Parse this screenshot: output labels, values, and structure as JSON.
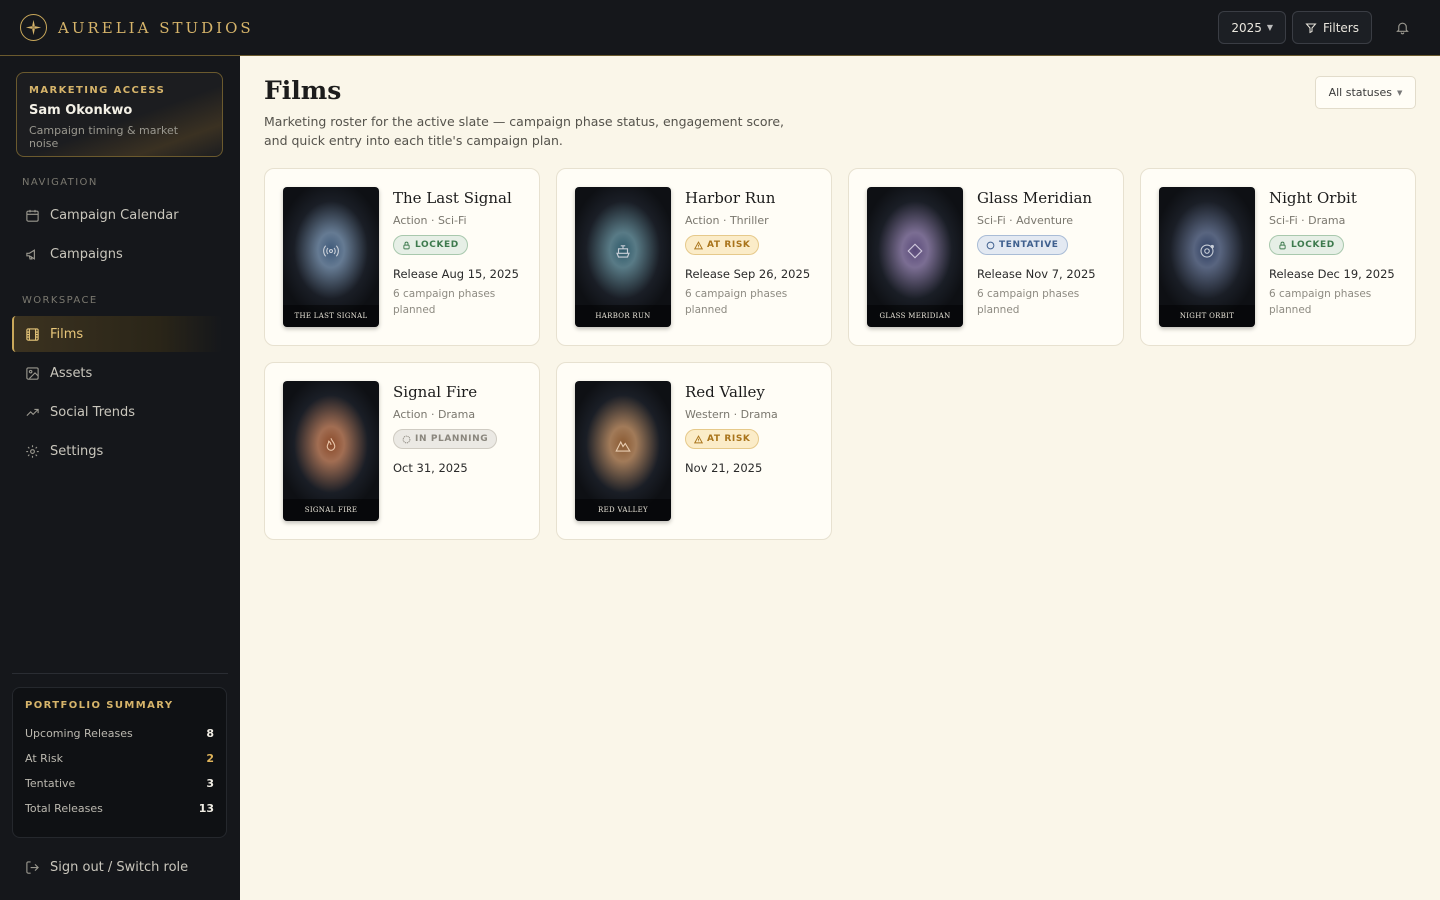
{
  "brand": {
    "name": "AURELIA STUDIOS",
    "icon": "star-compass-icon"
  },
  "topbar": {
    "year": "2025",
    "filters_label": "Filters"
  },
  "sidebar": {
    "access": {
      "label": "MARKETING ACCESS",
      "name": "Sam Okonkwo",
      "subtitle": "Campaign timing & market noise"
    },
    "navigation_label": "NAVIGATION",
    "navigation": [
      {
        "label": "Campaign Calendar",
        "icon": "calendar-icon"
      },
      {
        "label": "Campaigns",
        "icon": "megaphone-icon"
      }
    ],
    "workspace_label": "WORKSPACE",
    "workspace": [
      {
        "label": "Films",
        "icon": "film-icon",
        "active": true
      },
      {
        "label": "Assets",
        "icon": "image-icon"
      },
      {
        "label": "Social Trends",
        "icon": "trending-icon"
      },
      {
        "label": "Settings",
        "icon": "gear-icon"
      }
    ],
    "summary": {
      "title": "PORTFOLIO SUMMARY",
      "rows": [
        {
          "label": "Upcoming Releases",
          "value": "8"
        },
        {
          "label": "At Risk",
          "value": "2"
        },
        {
          "label": "Tentative",
          "value": "3"
        },
        {
          "label": "Total Releases",
          "value": "13"
        }
      ]
    },
    "signout_label": "Sign out / Switch role"
  },
  "main": {
    "title": "Films",
    "description": "Marketing roster for the active slate — campaign phase status, engagement score, and quick entry into each title's campaign plan.",
    "status_filter": "All statuses",
    "films": [
      {
        "title": "The Last Signal",
        "genre": "Action · Sci-Fi",
        "status": "LOCKED",
        "status_type": "locked",
        "release": "Release Aug 15, 2025",
        "phases": "6 campaign phases planned",
        "poster_title": "THE LAST SIGNAL",
        "poster_icon": "broadcast-icon",
        "poster_color": "#3f5a7a"
      },
      {
        "title": "Harbor Run",
        "genre": "Action · Thriller",
        "status": "AT RISK",
        "status_type": "risk",
        "release": "Release Sep 26, 2025",
        "phases": "6 campaign phases planned",
        "poster_title": "HARBOR RUN",
        "poster_icon": "ship-icon",
        "poster_color": "#2f5a6a"
      },
      {
        "title": "Glass Meridian",
        "genre": "Sci-Fi · Adventure",
        "status": "TENTATIVE",
        "status_type": "tentative",
        "release": "Release Nov 7, 2025",
        "phases": "6 campaign phases planned",
        "poster_title": "GLASS MERIDIAN",
        "poster_icon": "diamond-icon",
        "poster_color": "#5a4a7a"
      },
      {
        "title": "Night Orbit",
        "genre": "Sci-Fi · Drama",
        "status": "LOCKED",
        "status_type": "locked",
        "release": "Release Dec 19, 2025",
        "phases": "6 campaign phases planned",
        "poster_title": "NIGHT ORBIT",
        "poster_icon": "orbit-icon",
        "poster_color": "#2f3f62"
      },
      {
        "title": "Signal Fire",
        "genre": "Action · Drama",
        "status": "IN PLANNING",
        "status_type": "planning",
        "release": "Oct 31, 2025",
        "phases": "",
        "poster_title": "SIGNAL FIRE",
        "poster_icon": "flame-icon",
        "poster_color": "#8a4a2a"
      },
      {
        "title": "Red Valley",
        "genre": "Western · Drama",
        "status": "AT RISK",
        "status_type": "risk",
        "release": "Nov 21, 2025",
        "phases": "",
        "poster_title": "RED VALLEY",
        "poster_icon": "mountain-icon",
        "poster_color": "#8a5a32"
      }
    ]
  },
  "colors": {
    "accent": "#d6b46a",
    "sidebar_bg": "#15171b",
    "page_bg": "#faf6e9"
  }
}
